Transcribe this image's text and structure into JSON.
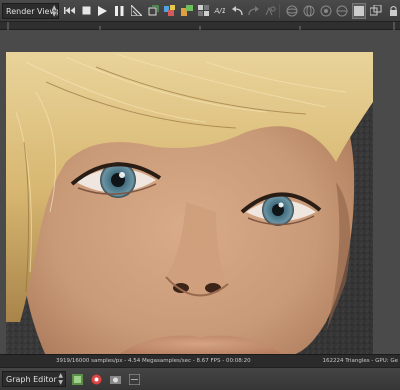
{
  "toolbar": {
    "viewport_select": "Render Viewport",
    "icons": [
      "reset-icon",
      "stop-icon",
      "play-icon",
      "pause-icon",
      "pick-icon",
      "film-region-icon",
      "copy-icon",
      "move-icon",
      "swatch-icon",
      "xy-zoom-icon",
      "undo-icon",
      "redo-icon",
      "camera-icon",
      "sphere-icon",
      "globe-icon",
      "panel-icon",
      "scale-icon",
      "lock-icon"
    ]
  },
  "status": {
    "left_text": "3919/16000 samples/px - 4.54 Megasamples/sec - 8.67 FPS - 00:08:20",
    "right_text": "162224 Triangles - GPU: Ge"
  },
  "graph_editor": {
    "select_label": "Graph Editor",
    "icons": [
      "node-graph-icon",
      "color-node-icon",
      "render-node-icon",
      "collapse-icon"
    ]
  },
  "colors": {
    "toolbar_bg": "#3f3f3f",
    "viewport_bg": "#4a4a4a",
    "strip_bg": "#8c8c8c",
    "status_bg": "#2b2b2b"
  }
}
